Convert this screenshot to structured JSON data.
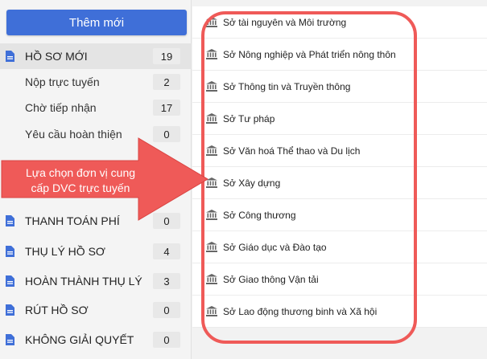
{
  "sidebar": {
    "add_button": "Thêm mới",
    "items": [
      {
        "label": "HỒ SƠ MỚI",
        "count": "19"
      },
      {
        "label": "Nộp trực tuyến",
        "count": "2"
      },
      {
        "label": "Chờ tiếp nhận",
        "count": "17"
      },
      {
        "label": "Yêu cầu hoàn thiện",
        "count": "0"
      },
      {
        "label": "THANH TOÁN PHÍ",
        "count": "0"
      },
      {
        "label": "THỤ LÝ HỒ SƠ",
        "count": "4"
      },
      {
        "label": "HOÀN THÀNH THỤ LÝ",
        "count": "3"
      },
      {
        "label": "RÚT HỒ SƠ",
        "count": "0"
      },
      {
        "label": "KHÔNG GIẢI QUYẾT",
        "count": "0"
      }
    ]
  },
  "departments": [
    "Sở tài nguyên và Môi trường",
    "Sở Nông nghiệp và Phát triển nông thôn",
    "Sở Thông tin và Truyền thông",
    "Sở Tư pháp",
    "Sở Văn hoá Thể thao và Du lịch",
    "Sở Xây dựng",
    "Sở Công thương",
    "Sở Giáo dục và Đào tạo",
    "Sở Giao thông Vận tải",
    "Sở Lao động thương binh và Xã hội"
  ],
  "callout": {
    "line1": "Lựa chọn đơn vị cung",
    "line2": "cấp DVC trực tuyến"
  },
  "colors": {
    "accent": "#3f6fd8",
    "callout": "#ef5a58",
    "doc_icon": "#3f6fd8"
  }
}
